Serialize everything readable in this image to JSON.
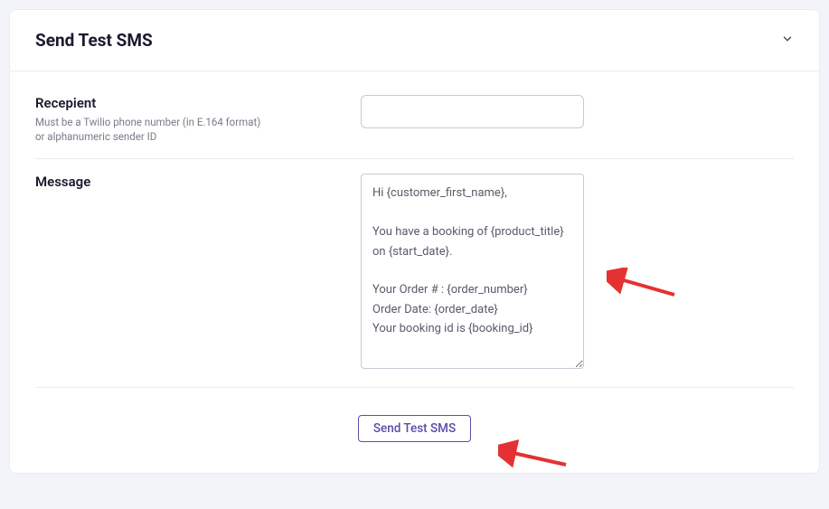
{
  "card": {
    "title": "Send Test SMS"
  },
  "recipient": {
    "label": "Recepient",
    "help": "Must be a Twilio phone number (in E.164 format) or alphanumeric sender ID",
    "value": ""
  },
  "message": {
    "label": "Message",
    "value": "Hi {customer_first_name},\n\nYou have a booking of {product_title} on {start_date}.\n\nYour Order # : {order_number}\nOrder Date: {order_date}\nYour booking id is {booking_id}"
  },
  "submit": {
    "label": "Send Test SMS"
  }
}
